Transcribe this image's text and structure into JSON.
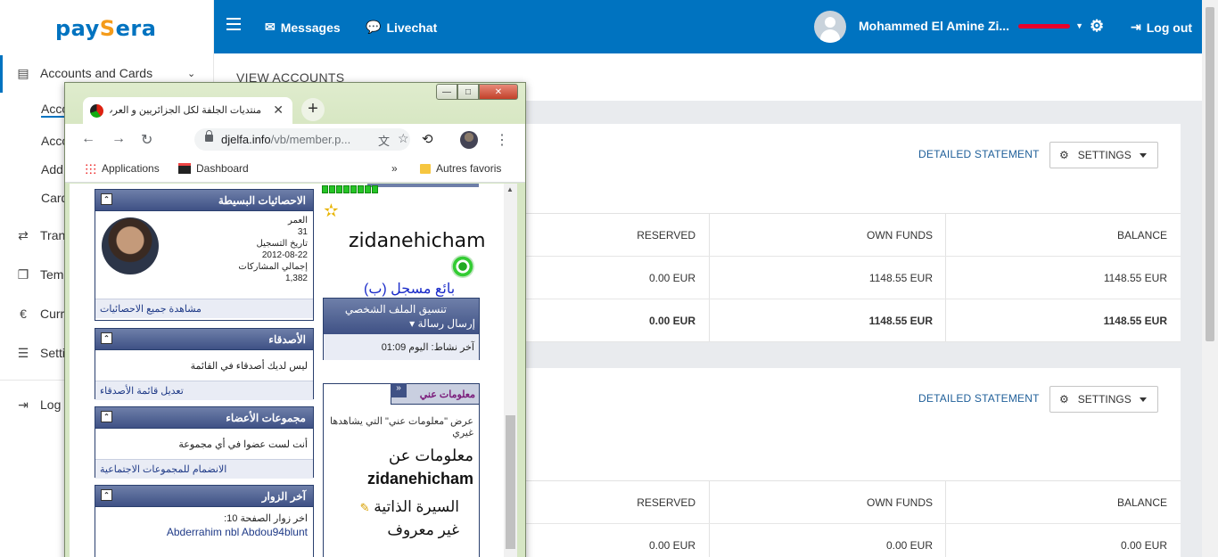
{
  "app": {
    "logo": {
      "part1": "pay",
      "part2": "S",
      "part3": "era"
    },
    "topbar": {
      "messages": "Messages",
      "livechat": "Livechat",
      "user_name": "Mohammed El Amine Zi...",
      "logout": "Log out"
    },
    "sidebar": {
      "accounts_cards": "Accounts and Cards",
      "sub_items": [
        "Acco",
        "Acco",
        "Add",
        "Card"
      ],
      "items": [
        "Tran",
        "Tem",
        "Curr",
        "Setti",
        "Log"
      ]
    },
    "main": {
      "view_accounts": "VIEW ACCOUNTS",
      "cards": [
        {
          "detailed_statement": "DETAILED STATEMENT",
          "settings": "SETTINGS",
          "headers": [
            "RESERVED",
            "OWN FUNDS",
            "BALANCE"
          ],
          "rows": [
            [
              "0.00 EUR",
              "1148.55 EUR",
              "1148.55 EUR"
            ],
            [
              "0.00 EUR",
              "1148.55 EUR",
              "1148.55 EUR"
            ]
          ]
        },
        {
          "detailed_statement": "DETAILED STATEMENT",
          "settings": "SETTINGS",
          "headers": [
            "RESERVED",
            "OWN FUNDS",
            "BALANCE"
          ],
          "rows": [
            [
              "0.00 EUR",
              "0.00 EUR",
              "0.00 EUR"
            ]
          ]
        }
      ]
    }
  },
  "browser": {
    "tab_title": "منتديات الجلفة لكل الجزائريين و العرب - مد",
    "url_domain": "djelfa.info",
    "url_path": "/vb/member.p...",
    "bookmarks": {
      "applications": "Applications",
      "dashboard": "Dashboard",
      "more": "»",
      "other": "Autres favoris"
    },
    "page": {
      "stats_title": "الاحصائيات البسيطة",
      "age_label": "العمر",
      "age_value": "31",
      "reg_label": "تاريخ التسجيل",
      "reg_value": "2012-08-22",
      "posts_label": "إجمالي المشاركات",
      "posts_value": "1,382",
      "stats_link": "مشاهدة جميع الاحصائيات",
      "friends_title": "الأصدقاء",
      "friends_text": "ليس لديك أصدقاء في القائمة",
      "friends_link": "تعديل قائمة الأصدقاء",
      "groups_title": "مجموعات الأعضاء",
      "groups_text": "أنت لست عضوا في أي مجموعة",
      "groups_link": "الانضمام للمجموعات الاجتماعية",
      "visitors_title": "آخر الزوار",
      "visitors_text": "اخر زوار الصفحة 10:",
      "visitors_names": "Abderrahim nbl  Abdou94blunt",
      "username": "zidanehicham",
      "rank": "بائع مسجل (ب)",
      "profile_style": "تنسيق الملف الشخصي",
      "send_message": "إرسال رسالة",
      "last_activity": "آخر نشاط: اليوم 01:09",
      "about_tab": "معلومات عني",
      "about_view": "عرض \"معلومات عني\" التي يشاهدها غيري",
      "about_heading": "معلومات عن",
      "about_name": "zidanehicham",
      "bio": "السيرة الذاتية",
      "bio_value": "غير معروف"
    }
  }
}
